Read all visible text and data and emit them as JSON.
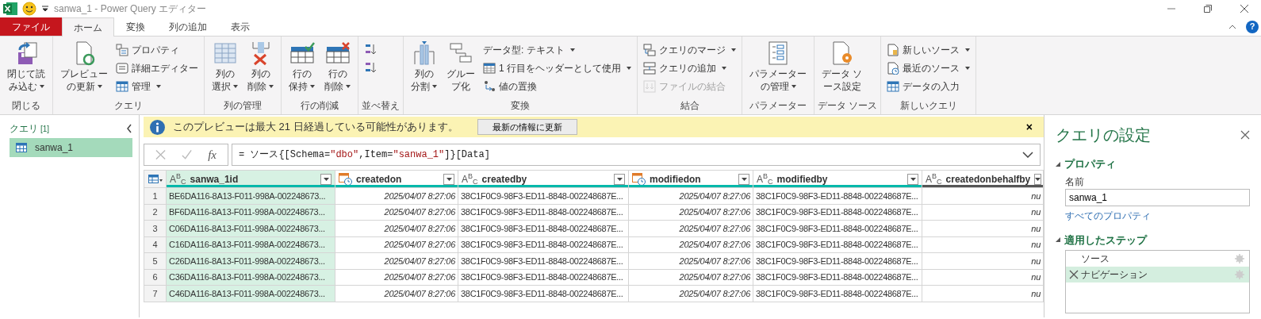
{
  "window": {
    "title": "sanwa_1 - Power Query エディター",
    "help": "?"
  },
  "tabs": [
    {
      "label": "ファイル",
      "kind": "file",
      "selected": false
    },
    {
      "label": "ホーム",
      "kind": "tab",
      "selected": true
    },
    {
      "label": "変換",
      "kind": "tab",
      "selected": false
    },
    {
      "label": "列の追加",
      "kind": "tab",
      "selected": false
    },
    {
      "label": "表示",
      "kind": "tab",
      "selected": false
    }
  ],
  "ribbon": {
    "groups": [
      {
        "label": "閉じる",
        "items": [
          {
            "kind": "large",
            "lines": [
              "閉じて読",
              "み込む"
            ],
            "dropdown": true,
            "disabled": false
          }
        ]
      },
      {
        "label": "クエリ",
        "items": [
          {
            "kind": "large",
            "lines": [
              "プレビュー",
              "の更新"
            ],
            "dropdown": true,
            "disabled": false
          },
          {
            "kind": "stack",
            "items": [
              {
                "kind": "small",
                "label": "プロパティ",
                "dropdown": false,
                "disabled": false
              },
              {
                "kind": "small",
                "label": "詳細エディター",
                "dropdown": false,
                "disabled": false
              },
              {
                "kind": "small",
                "label": "管理",
                "dropdown": true,
                "disabled": false
              }
            ]
          }
        ]
      },
      {
        "label": "列の管理",
        "items": [
          {
            "kind": "large",
            "lines": [
              "列の",
              "選択"
            ],
            "dropdown": true,
            "disabled": false
          },
          {
            "kind": "large",
            "lines": [
              "列の",
              "削除"
            ],
            "dropdown": true,
            "disabled": false
          }
        ]
      },
      {
        "label": "行の削減",
        "items": [
          {
            "kind": "large",
            "lines": [
              "行の",
              "保持"
            ],
            "dropdown": true,
            "disabled": false
          },
          {
            "kind": "large",
            "lines": [
              "行の",
              "削除"
            ],
            "dropdown": true,
            "disabled": false
          }
        ]
      },
      {
        "label": "並べ替え",
        "items": [
          {
            "kind": "stack",
            "items": [
              {
                "kind": "icon",
                "dropdown": false,
                "disabled": false
              },
              {
                "kind": "icon",
                "dropdown": false,
                "disabled": false
              }
            ]
          }
        ]
      },
      {
        "label": "変換",
        "items": [
          {
            "kind": "large",
            "lines": [
              "列の",
              "分割"
            ],
            "dropdown": true,
            "disabled": false
          },
          {
            "kind": "large",
            "lines": [
              "グルー",
              "プ化"
            ],
            "dropdown": false,
            "disabled": false
          },
          {
            "kind": "stack",
            "items": [
              {
                "kind": "small",
                "label": "データ型: テキスト",
                "dropdown": true,
                "disabled": false
              },
              {
                "kind": "small",
                "label": "1 行目をヘッダーとして使用",
                "dropdown": true,
                "disabled": false
              },
              {
                "kind": "small",
                "label": "値の置換",
                "dropdown": false,
                "disabled": false
              }
            ]
          }
        ]
      },
      {
        "label": "結合",
        "items": [
          {
            "kind": "stack",
            "items": [
              {
                "kind": "small",
                "label": "クエリのマージ",
                "dropdown": true,
                "disabled": false
              },
              {
                "kind": "small",
                "label": "クエリの追加",
                "dropdown": true,
                "disabled": false
              },
              {
                "kind": "small",
                "label": "ファイルの結合",
                "dropdown": false,
                "disabled": true
              }
            ]
          }
        ]
      },
      {
        "label": "パラメーター",
        "items": [
          {
            "kind": "large",
            "lines": [
              "パラメーター",
              "の管理"
            ],
            "dropdown": true,
            "disabled": false
          }
        ]
      },
      {
        "label": "データ ソース",
        "items": [
          {
            "kind": "large",
            "lines": [
              "データ ソ",
              "ース設定"
            ],
            "dropdown": false,
            "disabled": false
          }
        ]
      },
      {
        "label": "新しいクエリ",
        "items": [
          {
            "kind": "stack",
            "items": [
              {
                "kind": "small",
                "label": "新しいソース",
                "dropdown": true,
                "disabled": false
              },
              {
                "kind": "small",
                "label": "最近のソース",
                "dropdown": true,
                "disabled": false
              },
              {
                "kind": "small",
                "label": "データの入力",
                "dropdown": false,
                "disabled": false
              }
            ]
          }
        ]
      }
    ]
  },
  "queries": {
    "title": "クエリ",
    "count": "[1]",
    "items": [
      {
        "label": "sanwa_1",
        "selected": true
      }
    ]
  },
  "info_bar": {
    "message": "このプレビューは最大 21 日経過している可能性があります。",
    "button": "最新の情報に更新",
    "close": "×"
  },
  "formula_bar": {
    "fx": "fx",
    "parts": [
      {
        "text": "= ソース{[Schema=",
        "kind": "plain"
      },
      {
        "text": "\"dbo\"",
        "kind": "string"
      },
      {
        "text": ",Item=",
        "kind": "plain"
      },
      {
        "text": "\"sanwa_1\"",
        "kind": "string"
      },
      {
        "text": "]}[Data]",
        "kind": "plain"
      }
    ]
  },
  "table": {
    "columns": [
      {
        "name": "sanwa_1id",
        "kind": "text",
        "type_glyph": "A$^{B}$$_{C}$",
        "color": "#01b8aa",
        "selected": true
      },
      {
        "name": "createdon",
        "kind": "datetime",
        "color": "#01b8aa",
        "selected": false
      },
      {
        "name": "createdby",
        "kind": "text",
        "type_glyph": "A$^{B}$$_{C}$",
        "color": "#01b8aa",
        "selected": false
      },
      {
        "name": "modifiedon",
        "kind": "datetime",
        "color": "#01b8aa",
        "selected": false
      },
      {
        "name": "modifiedby",
        "kind": "text",
        "type_glyph": "A$^{B}$$_{C}$",
        "color": "#01b8aa",
        "selected": false
      },
      {
        "name": "createdonbehalfby",
        "kind": "text",
        "type_glyph": "A$^{B}$$_{C}$",
        "color": "#555555",
        "selected": false
      }
    ],
    "rows": [
      {
        "number": "1",
        "cells": [
          "BE6DA116-8A13-F011-998A-002248673...",
          "2025/04/07 8:27:06",
          "38C1F0C9-98F3-ED11-8848-002248687E...",
          "2025/04/07 8:27:06",
          "38C1F0C9-98F3-ED11-8848-002248687E...",
          "nu"
        ]
      },
      {
        "number": "2",
        "cells": [
          "BF6DA116-8A13-F011-998A-002248673...",
          "2025/04/07 8:27:06",
          "38C1F0C9-98F3-ED11-8848-002248687E...",
          "2025/04/07 8:27:06",
          "38C1F0C9-98F3-ED11-8848-002248687E...",
          "nu"
        ]
      },
      {
        "number": "3",
        "cells": [
          "C06DA116-8A13-F011-998A-002248673...",
          "2025/04/07 8:27:06",
          "38C1F0C9-98F3-ED11-8848-002248687E...",
          "2025/04/07 8:27:06",
          "38C1F0C9-98F3-ED11-8848-002248687E...",
          "nu"
        ]
      },
      {
        "number": "4",
        "cells": [
          "C16DA116-8A13-F011-998A-002248673...",
          "2025/04/07 8:27:06",
          "38C1F0C9-98F3-ED11-8848-002248687E...",
          "2025/04/07 8:27:06",
          "38C1F0C9-98F3-ED11-8848-002248687E...",
          "nu"
        ]
      },
      {
        "number": "5",
        "cells": [
          "C26DA116-8A13-F011-998A-002248673...",
          "2025/04/07 8:27:06",
          "38C1F0C9-98F3-ED11-8848-002248687E...",
          "2025/04/07 8:27:06",
          "38C1F0C9-98F3-ED11-8848-002248687E...",
          "nu"
        ]
      },
      {
        "number": "6",
        "cells": [
          "C36DA116-8A13-F011-998A-002248673...",
          "2025/04/07 8:27:06",
          "38C1F0C9-98F3-ED11-8848-002248687E...",
          "2025/04/07 8:27:06",
          "38C1F0C9-98F3-ED11-8848-002248687E...",
          "nu"
        ]
      },
      {
        "number": "7",
        "cells": [
          "C46DA116-8A13-F011-998A-002248673...",
          "2025/04/07 8:27:06",
          "38C1F0C9-98F3-ED11-8848-002248687E...",
          "2025/04/07 8:27:06",
          "38C1F0C9-98F3-ED11-8848-002248687E...",
          "nu"
        ]
      }
    ]
  },
  "settings": {
    "title": "クエリの設定",
    "properties_heading": "プロパティ",
    "name_label": "名前",
    "name_value": "sanwa_1",
    "all_properties_link": "すべてのプロパティ",
    "steps_heading": "適用したステップ",
    "steps": [
      {
        "label": "ソース",
        "selected": false
      },
      {
        "label": "ナビゲーション",
        "selected": true
      }
    ]
  }
}
